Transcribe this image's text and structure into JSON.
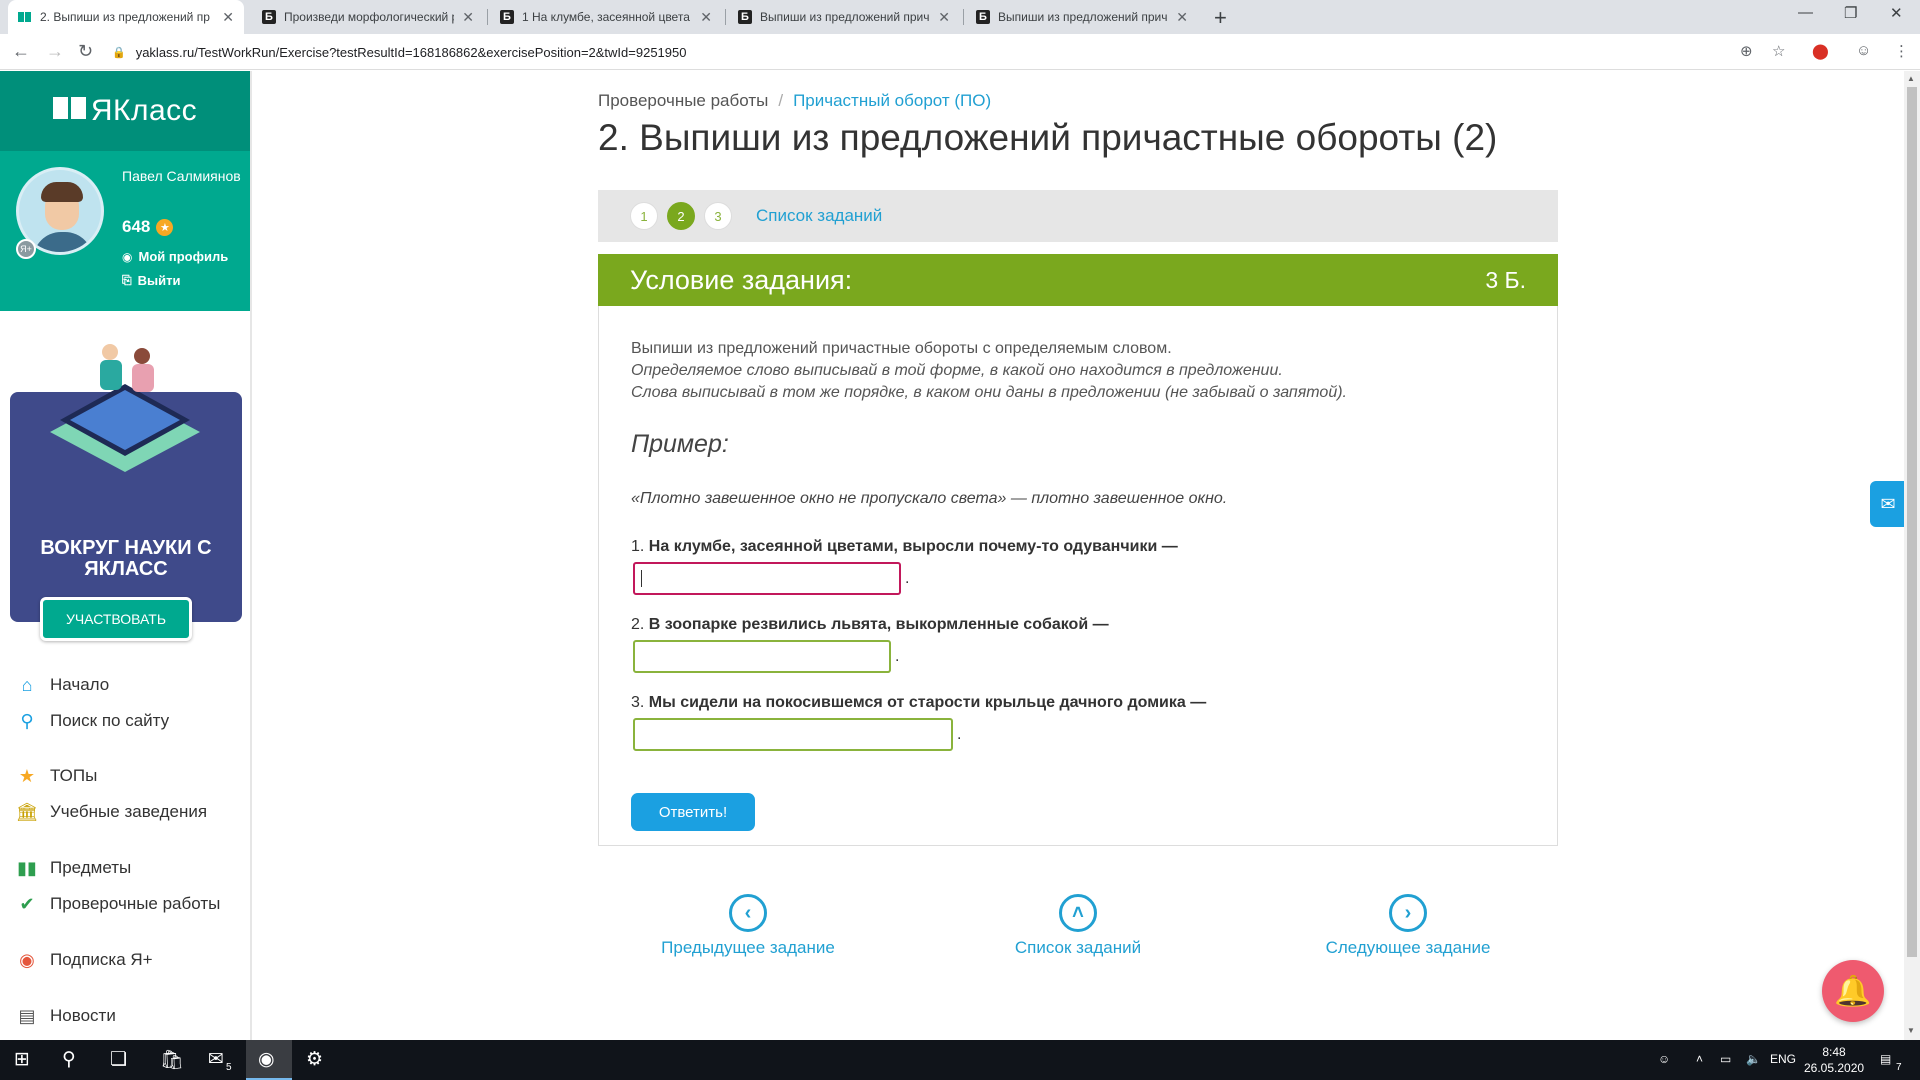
{
  "browser": {
    "tabs": [
      {
        "title": "2. Выпиши из предложений пр",
        "active": true,
        "favicon": "yaklass-icon"
      },
      {
        "title": "Произведи морфологический р",
        "active": false,
        "favicon": "b-icon"
      },
      {
        "title": "1 На клумбе, засеянной цвета",
        "active": false,
        "favicon": "b-icon"
      },
      {
        "title": "Выпиши из предложений прич",
        "active": false,
        "favicon": "b-icon"
      },
      {
        "title": "Выпиши из предложений прич",
        "active": false,
        "favicon": "b-icon"
      }
    ],
    "url": "yaklass.ru/TestWorkRun/Exercise?testResultId=168186862&exercisePosition=2&twId=9251950"
  },
  "sidebar": {
    "logo": "ЯКласс",
    "user": {
      "name": "Павел Салмиянов",
      "points": "648"
    },
    "profile_link": "Мой профиль",
    "logout_link": "Выйти",
    "banner": {
      "title": "ВОКРУГ НАУКИ С ЯКЛАСС",
      "button": "УЧАСТВОВАТЬ"
    },
    "menu": [
      {
        "label": "Начало",
        "icon": "home-icon"
      },
      {
        "label": "Поиск по сайту",
        "icon": "search-icon"
      },
      {
        "label": "ТОПы",
        "icon": "star-icon"
      },
      {
        "label": "Учебные заведения",
        "icon": "institution-icon"
      },
      {
        "label": "Предметы",
        "icon": "book-icon"
      },
      {
        "label": "Проверочные работы",
        "icon": "check-icon"
      },
      {
        "label": "Подписка Я+",
        "icon": "subscription-icon"
      },
      {
        "label": "Новости",
        "icon": "news-icon"
      }
    ]
  },
  "main": {
    "breadcrumb": {
      "root": "Проверочные работы",
      "current": "Причастный оборот (ПО)"
    },
    "title": "2. Выпиши из предложений причастные обороты (2)",
    "steps": [
      "1",
      "2",
      "3"
    ],
    "current_step": "2",
    "task_list_link": "Список заданий",
    "task_header": "Условие задания:",
    "task_points": "3 Б.",
    "instructions": [
      "Выпиши из предложений причастные обороты с определяемым словом.",
      "Определяемое слово выписывай в той форме, в какой оно находится в предложении.",
      "Слова выписывай в том же порядке, в каком они даны в предложении (не забывай о запятой)."
    ],
    "example_title": "Пример:",
    "example": "«Плотно завешенное окно не пропускало света» — плотно завешенное окно.",
    "questions": [
      {
        "num": "1.",
        "text": "На клумбе, засеянной цветами, выросли почему-то одуванчики —",
        "value": ""
      },
      {
        "num": "2.",
        "text": "В зоопарке резвились львята, выкормленные собакой —",
        "value": ""
      },
      {
        "num": "3.",
        "text": "Мы сидели на покосившемся от старости крыльце дачного домика —",
        "value": ""
      }
    ],
    "submit_label": "Ответить!",
    "nav": {
      "prev": "Предыдущее задание",
      "list": "Список заданий",
      "next": "Следующее задание"
    }
  },
  "taskbar": {
    "mail_badge": "5",
    "lang": "ENG",
    "time": "8:48",
    "date": "26.05.2020",
    "notifications": "7"
  },
  "colors": {
    "brand_teal": "#00a98f",
    "task_green": "#7aa81e",
    "link_blue": "#21a0d2",
    "button_blue": "#1ba0e1"
  }
}
